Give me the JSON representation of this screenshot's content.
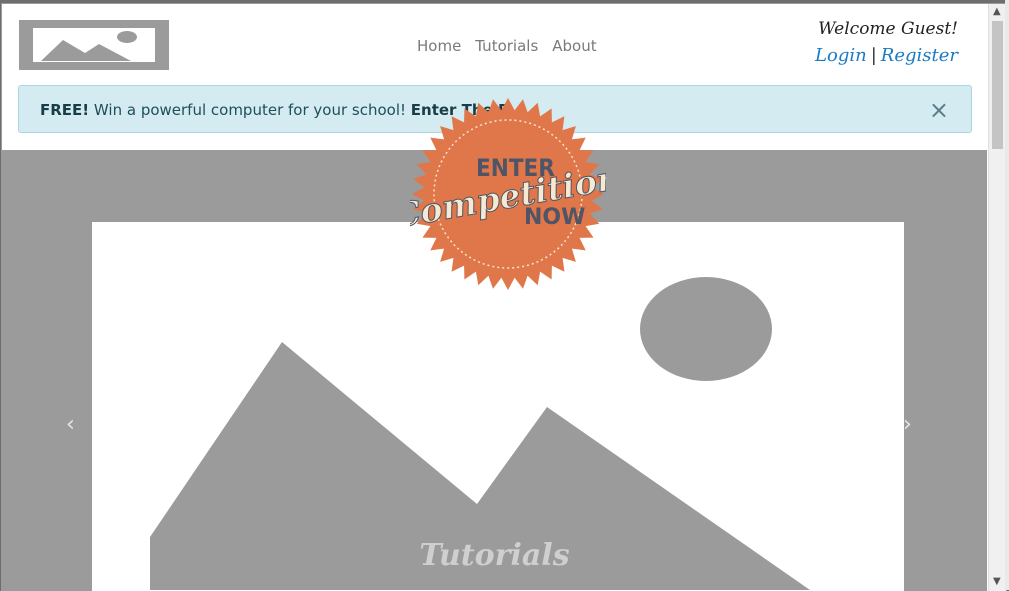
{
  "nav": {
    "items": [
      "Home",
      "Tutorials",
      "About"
    ]
  },
  "user": {
    "greeting": "Welcome Guest!",
    "login": "Login",
    "separator": "|",
    "register": "Register"
  },
  "alert": {
    "free": "FREE!",
    "message": " Win a powerful computer for your school! ",
    "cta": "Enter The D",
    "close": "×"
  },
  "badge": {
    "line1": "ENTER",
    "line2": "Competition",
    "line3": "NOW",
    "color": "#e0774a"
  },
  "carousel": {
    "caption": "Tutorials",
    "prev": "‹",
    "next": "›"
  },
  "scrollbar": {
    "up": "▲",
    "down": "▼"
  },
  "colors": {
    "link": "#1a7bc4",
    "alert_bg": "#d4ecf1",
    "placeholder": "#9b9b9b"
  }
}
